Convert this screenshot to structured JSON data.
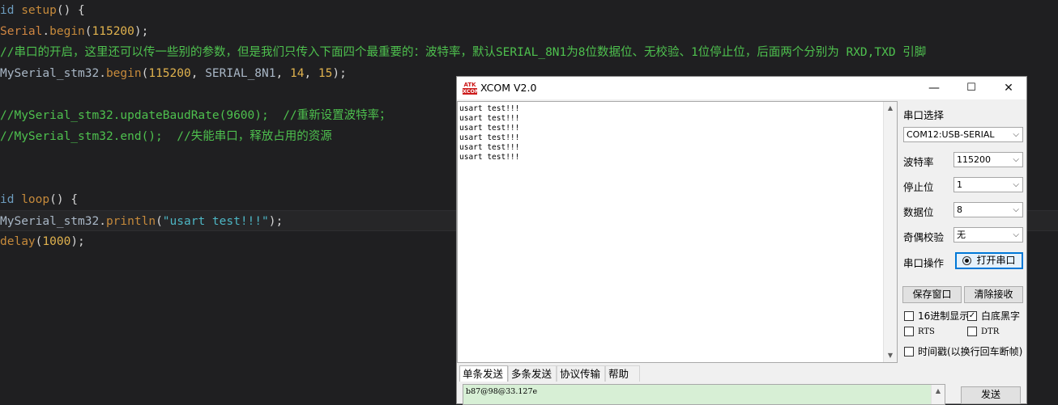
{
  "editor": {
    "l1": {
      "kw": "id",
      "fn": "setup",
      "rest": "() {"
    },
    "l2": {
      "obj": "Serial",
      "dot": ".",
      "fn": "begin",
      "p1": "(",
      "num": "115200",
      "p2": ");"
    },
    "l3": {
      "comment": "//串口的开启，这里还可以传一些别的参数，但是我们只传入下面四个最重要的：波特率，默认SERIAL_8N1为8位数据位、无校验、1位停止位，后面两个分别为 RXD,TXD 引脚"
    },
    "l4": {
      "obj": "MySerial_stm32",
      "dot": ".",
      "fn": "begin",
      "p1": "(",
      "num1": "115200",
      "s1": ", ",
      "id": "SERIAL_8N1",
      "s2": ", ",
      "num2": "14",
      "s3": ", ",
      "num3": "15",
      "p2": ");"
    },
    "l6": {
      "comment": "//MySerial_stm32.updateBaudRate(9600);  //重新设置波特率；"
    },
    "l7": {
      "comment": "//MySerial_stm32.end();  //失能串口，释放占用的资源"
    },
    "l10": {
      "kw": "id",
      "fn": "loop",
      "rest": "() {"
    },
    "l11": {
      "obj": "MySerial_stm32",
      "dot": ".",
      "fn": "println",
      "p1": "(",
      "str": "\"usart test!!!\"",
      "p2": ");"
    },
    "l12": {
      "fn": "delay",
      "p1": "(",
      "num": "1000",
      "p2": ");"
    }
  },
  "xcom": {
    "icon_top": "ATK",
    "icon_bottom": "XCOM",
    "title": "XCOM V2.0",
    "minimize": "—",
    "maximize": "☐",
    "close": "✕",
    "receive_lines": "usart test!!!\nusart test!!!\nusart test!!!\nusart test!!!\nusart test!!!\nusart test!!!",
    "port_select_label": "串口选择",
    "port_value": "COM12:USB-SERIAL",
    "baud_label": "波特率",
    "baud_value": "115200",
    "stop_label": "停止位",
    "stop_value": "1",
    "data_label": "数据位",
    "data_value": "8",
    "parity_label": "奇偶校验",
    "parity_value": "无",
    "op_label": "串口操作",
    "open_port": "打开串口",
    "save_window": "保存窗口",
    "clear_recv": "清除接收",
    "hex_display": "16进制显示",
    "white_bg": "白底黑字",
    "rts": "RTS",
    "dtr": "DTR",
    "timestamp": "时间戳(以换行回车断帧)",
    "tabs": [
      "单条发送",
      "多条发送",
      "协议传输",
      "帮助"
    ],
    "send_text": "b87@98@33.127e",
    "send_button": "发送"
  }
}
